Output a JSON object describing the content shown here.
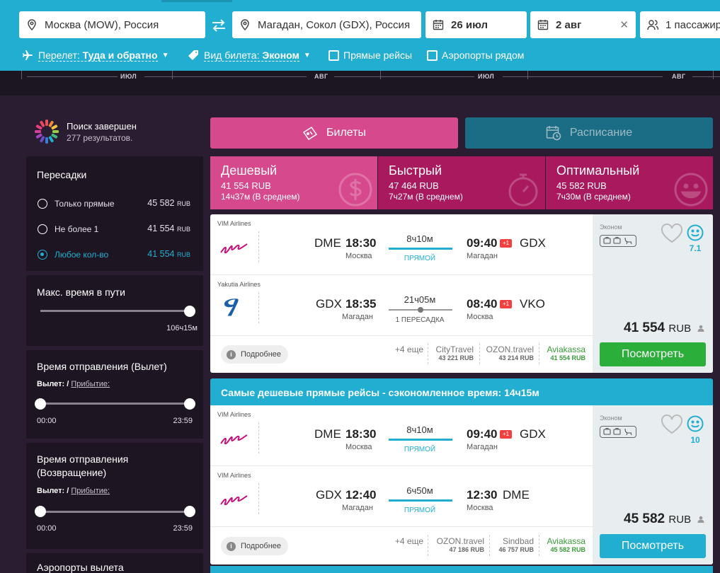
{
  "colors": {
    "header": "#22aed1",
    "page_bg": "#2a1d31",
    "panel": "#1d1622",
    "tab_pink": "#d64a8d",
    "tab_magenta": "#a8195d",
    "tab_teal": "#1a6d84",
    "green_button": "#2bae3a",
    "blue_button": "#22aed1",
    "accent": "#22aed1"
  },
  "search": {
    "origin": "Москва (MOW), Россия",
    "destination": "Магадан, Сокол (GDX), Россия",
    "depart_date": "26 июл",
    "return_date": "2 авг",
    "passengers": "1 пассажир",
    "trip_type_label": "Перелет: ",
    "trip_type_value": "Туда и обратно",
    "ticket_type_label": "Вид билета: ",
    "ticket_type_value": "Эконом",
    "direct_only": "Прямые рейсы",
    "nearby_airports": "Аэропорты рядом"
  },
  "calendar": {
    "months": [
      "ИЮЛ",
      "АВГ",
      "ИЮЛ",
      "АВГ"
    ]
  },
  "status": {
    "title": "Поиск завершен",
    "count": "277 результатов."
  },
  "filters": {
    "stops": {
      "title": "Пересадки",
      "options": [
        {
          "label": "Только прямые",
          "price": "45 582",
          "cur": "RUB",
          "selected": false
        },
        {
          "label": "Не более 1",
          "price": "41 554",
          "cur": "RUB",
          "selected": false
        },
        {
          "label": "Любое кол-во",
          "price": "41 554",
          "cur": "RUB",
          "selected": true
        }
      ]
    },
    "max_duration": {
      "title": "Макс. время в пути",
      "value": "106ч15м",
      "level": 1.0
    },
    "depart_time_out": {
      "title": "Время отправления (Вылет)",
      "switch_a": "Вылет: / ",
      "switch_b": "Прибытие:",
      "min": "00:00",
      "max": "23:59"
    },
    "depart_time_ret": {
      "title_line1": "Время отправления",
      "title_line2": "(Возвращение)",
      "switch_a": "Вылет: / ",
      "switch_b": "Прибытие:",
      "min": "00:00",
      "max": "23:59"
    },
    "airports": {
      "title": "Аэропорты вылета"
    }
  },
  "tabs": {
    "tickets": "Билеты",
    "schedule": "Расписание"
  },
  "sort": [
    {
      "title": "Дешевый",
      "price": "41 554 RUB",
      "duration": "14ч37м (В среднем)",
      "icon": "dollar-icon"
    },
    {
      "title": "Быстрый",
      "price": "47 464 RUB",
      "duration": "7ч27м (В среднем)",
      "icon": "stopwatch-icon"
    },
    {
      "title": "Оптимальный",
      "price": "45 582 RUB",
      "duration": "7ч30м (В среднем)",
      "icon": "smiley-icon"
    }
  ],
  "results": [
    {
      "segments": [
        {
          "airline": "VIM Airlines",
          "from_code": "DME",
          "from_time": "18:30",
          "from_city": "Москва",
          "duration": "8ч10м",
          "stops": "ПРЯМОЙ",
          "to_time": "09:40",
          "plus": "+1",
          "to_code": "GDX",
          "to_city": "Магадан"
        },
        {
          "airline": "Yakutia Airlines",
          "from_code": "GDX",
          "from_time": "18:35",
          "from_city": "Магадан",
          "duration": "21ч05м",
          "stops": "1 ПЕРЕСАДКА",
          "to_time": "08:40",
          "plus": "+1",
          "to_code": "VKO",
          "to_city": "Москва"
        }
      ],
      "more_button": "Подробнее",
      "more_agents": "+4 еще",
      "agents": [
        {
          "name": "CityTravel",
          "price": "43 221 RUB"
        },
        {
          "name": "OZON.travel",
          "price": "43 214 RUB"
        },
        {
          "name": "Aviakassa",
          "price": "41 554 RUB"
        }
      ],
      "class": "Эконом",
      "score": "7.1",
      "price": "41 554",
      "currency": "RUB",
      "button": "Посмотреть"
    },
    {
      "banner": "Самые дешевые прямые рейсы - сэкономленное время: 14ч15м",
      "segments": [
        {
          "airline": "VIM Airlines",
          "from_code": "DME",
          "from_time": "18:30",
          "from_city": "Москва",
          "duration": "8ч10м",
          "stops": "ПРЯМОЙ",
          "to_time": "09:40",
          "plus": "+1",
          "to_code": "GDX",
          "to_city": "Магадан"
        },
        {
          "airline": "VIM Airlines",
          "from_code": "GDX",
          "from_time": "12:40",
          "from_city": "Магадан",
          "duration": "6ч50м",
          "stops": "ПРЯМОЙ",
          "to_time": "12:30",
          "plus": "",
          "to_code": "DME",
          "to_city": "Москва"
        }
      ],
      "more_button": "Подробнее",
      "more_agents": "+4 еще",
      "agents": [
        {
          "name": "OZON.travel",
          "price": "47 186 RUB"
        },
        {
          "name": "Sindbad",
          "price": "46 757 RUB"
        },
        {
          "name": "Aviakassa",
          "price": "45 582 RUB"
        }
      ],
      "class": "Эконом",
      "score": "10",
      "price": "45 582",
      "currency": "RUB",
      "button": "Посмотреть"
    }
  ]
}
